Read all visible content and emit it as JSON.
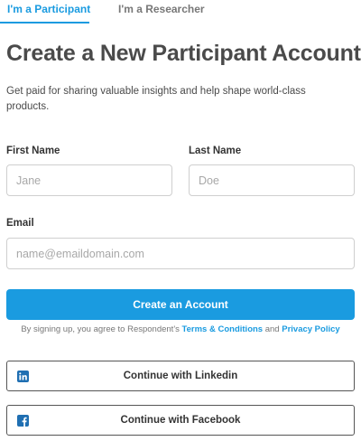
{
  "tabs": {
    "participant": "I'm a Participant",
    "researcher": "I'm a Researcher"
  },
  "header": {
    "title": "Create a New Participant Account",
    "subtitle": "Get paid for sharing valuable insights and help shape world-class products."
  },
  "form": {
    "first_name": {
      "label": "First Name",
      "placeholder": "Jane",
      "value": ""
    },
    "last_name": {
      "label": "Last Name",
      "placeholder": "Doe",
      "value": ""
    },
    "email": {
      "label": "Email",
      "placeholder": "name@emaildomain.com",
      "value": ""
    },
    "submit_label": "Create an Account"
  },
  "terms": {
    "prefix": "By signing up, you agree to Respondent's ",
    "terms_link": "Terms & Conditions",
    "and": " and ",
    "privacy_link": "Privacy Policy"
  },
  "social": {
    "linkedin": {
      "label": "Continue with Linkedin",
      "icon": "linkedin-icon"
    },
    "facebook": {
      "label": "Continue with Facebook",
      "icon": "facebook-icon"
    }
  },
  "colors": {
    "accent": "#1a9be0",
    "brand_icon": "#1f6fb2",
    "heading": "#4a4a4a",
    "muted": "#777777"
  }
}
